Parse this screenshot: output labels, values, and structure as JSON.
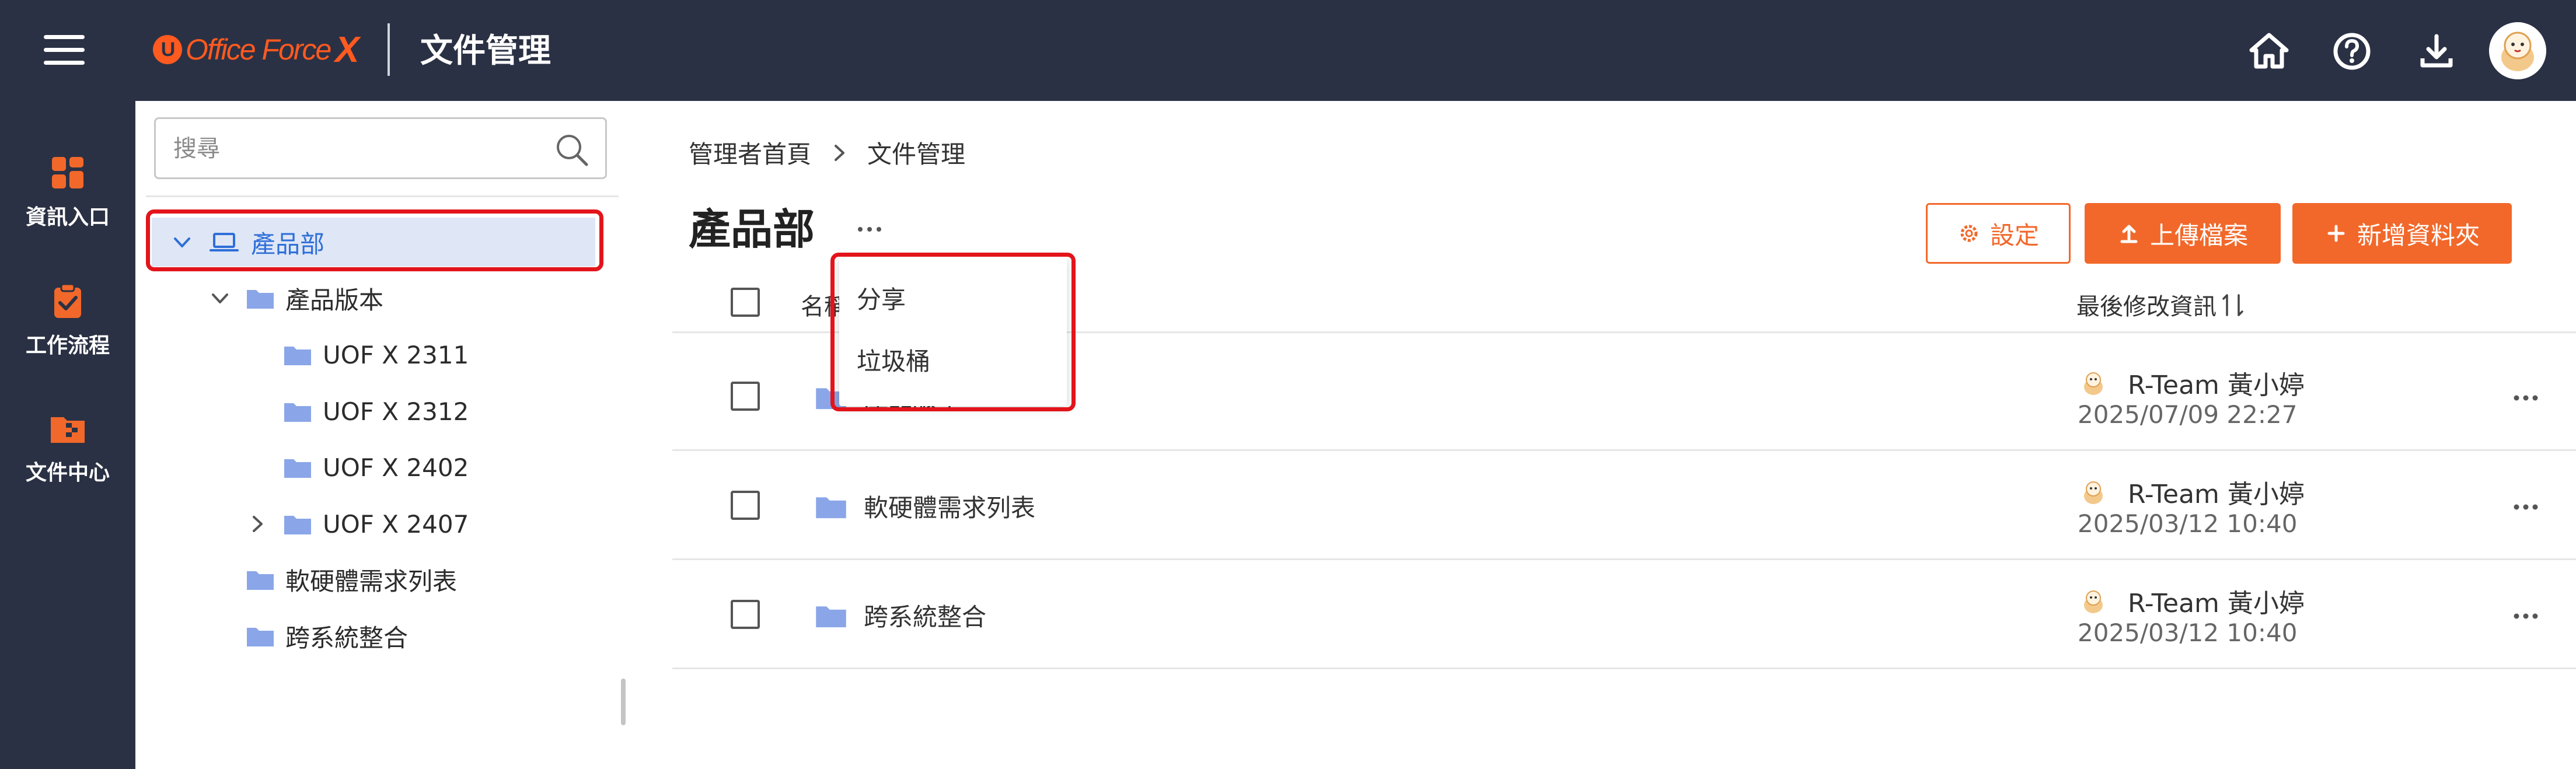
{
  "header": {
    "logo_text": "Office Force",
    "logo_suffix": "X",
    "logo_mark": "U",
    "title": "文件管理",
    "icons": [
      "home-icon",
      "help-icon",
      "download-icon"
    ]
  },
  "rail": {
    "items": [
      {
        "label": "資訊入口",
        "icon": "portal-icon"
      },
      {
        "label": "工作流程",
        "icon": "workflow-icon"
      },
      {
        "label": "文件中心",
        "icon": "document-center-icon"
      }
    ]
  },
  "tree": {
    "search_placeholder": "搜尋",
    "root": "產品部",
    "nodes": [
      "產品版本",
      "UOF X 2311",
      "UOF X 2312",
      "UOF X 2402",
      "UOF X 2407",
      "軟硬體需求列表",
      "跨系統整合"
    ]
  },
  "main": {
    "breadcrumb": [
      "管理者首頁",
      "文件管理"
    ],
    "title": "產品部",
    "buttons": {
      "settings": "設定",
      "upload": "上傳檔案",
      "new_folder": "新增資料夾"
    },
    "columns": {
      "name": "名稱",
      "modified": "最後修改資訊"
    },
    "rows": [
      {
        "name": "產品版本",
        "user": "R-Team 黃小婷",
        "time": "2025/07/09 22:27"
      },
      {
        "name": "軟硬體需求列表",
        "user": "R-Team 黃小婷",
        "time": "2025/03/12 10:40"
      },
      {
        "name": "跨系統整合",
        "user": "R-Team 黃小婷",
        "time": "2025/03/12 10:40"
      }
    ]
  },
  "menu": {
    "items": [
      "分享",
      "垃圾桶"
    ]
  },
  "colors": {
    "header_bg": "#2b3144",
    "accent": "#f2682a",
    "highlight_frame": "#e3141b",
    "tree_selected": "#dfe6f6",
    "folder": "#8aa6e8",
    "link_blue": "#2e6fd8"
  }
}
